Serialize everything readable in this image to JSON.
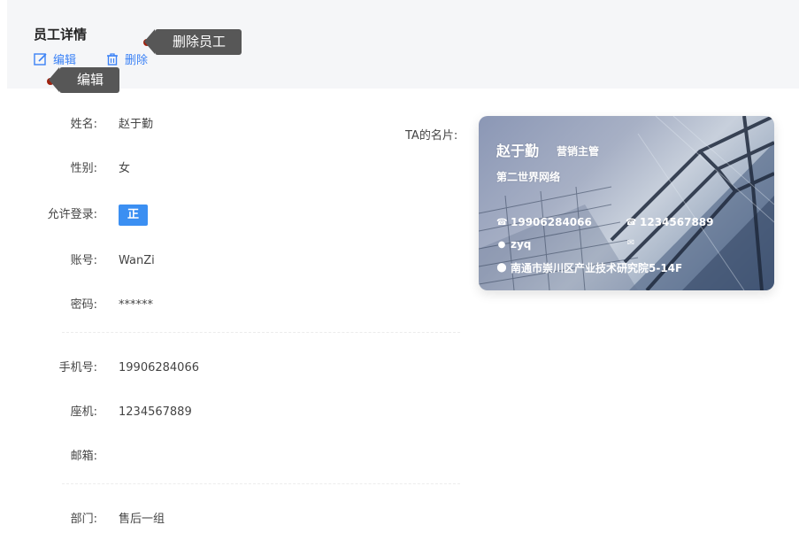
{
  "header": {
    "title": "员工详情",
    "edit_label": "编辑",
    "delete_label": "删除"
  },
  "tooltips": {
    "delete_tip": "删除员工",
    "edit_tip": "编辑"
  },
  "fields": {
    "name": {
      "label": "姓名:",
      "value": "赵于勤"
    },
    "gender": {
      "label": "性别:",
      "value": "女"
    },
    "login": {
      "label": "允许登录:",
      "value": "正常"
    },
    "account": {
      "label": "账号:",
      "value": "WanZi"
    },
    "password": {
      "label": "密码:",
      "value": "******"
    },
    "mobile": {
      "label": "手机号:",
      "value": "19906284066"
    },
    "landline": {
      "label": "座机:",
      "value": "1234567889"
    },
    "email": {
      "label": "邮箱:",
      "value": ""
    },
    "department": {
      "label": "部门:",
      "value": "售后一组"
    }
  },
  "card": {
    "label": "TA的名片:",
    "name": "赵于勤",
    "title": "营销主管",
    "company": "第二世界网络",
    "mobile": "19906284066",
    "landline": "1234567889",
    "wechat": "zyq",
    "email": "",
    "address": "南通市崇川区产业技术研究院5-14F"
  },
  "colors": {
    "accent": "#3b8ff2",
    "link": "#3b82f6",
    "tooltip_bg": "#575757",
    "tooltip_dot": "#a0220f",
    "header_bg": "#f5f6f8"
  }
}
